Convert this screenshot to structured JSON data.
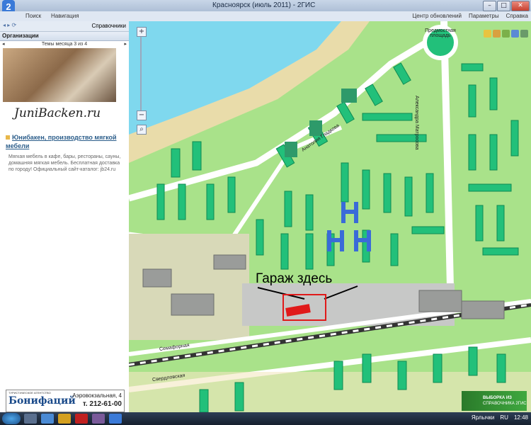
{
  "window": {
    "title": "Красноярск (июль 2011) - 2ГИС",
    "controls": [
      "–",
      "□",
      "✕"
    ]
  },
  "menubar": {
    "left": [
      "Поиск",
      "Навигация"
    ],
    "right": [
      "Центр обновлений",
      "Параметры",
      "Справка"
    ]
  },
  "leftpanel": {
    "toolbar_label": "Справочники",
    "section_title": "Организации",
    "themes_label": "Темы месяца 3 из 4",
    "ad": {
      "logo_text": "JuniBacken.ru",
      "title": "Юнибакен, производство мягкой мебели",
      "description": "Мягкая мебель в кафе, бары, рестораны, сауны, домашняя мягкая мебель. Бесплатная доставка по городу! Официальный сайт-каталог: jb24.ru"
    },
    "bottom_ad": {
      "brand": "Бонифаций",
      "tagline": "ТУРИСТИЧЕСКОЕ АГЕНТСТВО",
      "address": "Аэровокзальная, 4",
      "phone": "т. 212-61-00"
    }
  },
  "map": {
    "streets": [
      "Анатолия Гладкова",
      "Александра Матросова",
      "Семафорная",
      "Свердловская"
    ],
    "place_label": "Предмостная площадь",
    "annotation": "Гараж здесь",
    "banner_line1": "ВЫБОРКА ИЗ",
    "banner_line2": "СПРАВОЧНИКА 2ГИС",
    "colors": {
      "land": "#a9e28a",
      "river": "#7fd8ee",
      "sand": "#f0e6b9",
      "building": "#22c07a",
      "road": "#ffffff",
      "annot_box": "#e01a1a"
    }
  },
  "taskbar": {
    "lang": "RU",
    "tray_label": "Ярлычки",
    "time": "12:48"
  }
}
